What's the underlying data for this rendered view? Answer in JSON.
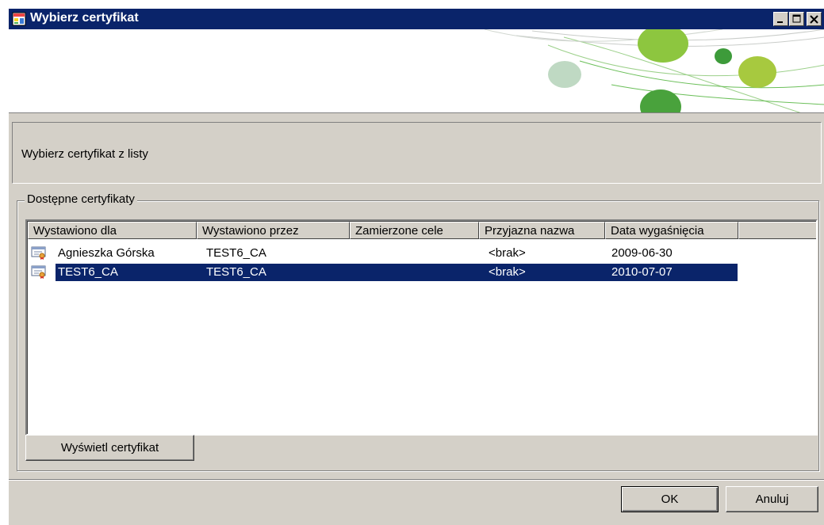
{
  "window": {
    "title": "Wybierz certyfikat"
  },
  "description": {
    "text": "Wybierz certyfikat z listy"
  },
  "group": {
    "label": "Dostępne certyfikaty"
  },
  "list": {
    "columns": [
      "Wystawiono dla",
      "Wystawiono przez",
      "Zamierzone cele",
      "Przyjazna nazwa",
      "Data wygaśnięcia"
    ],
    "rows": [
      [
        "Agnieszka Górska",
        "TEST6_CA",
        "",
        "<brak>",
        "2009-06-30"
      ],
      [
        "TEST6_CA",
        "TEST6_CA",
        "",
        "<brak>",
        "2010-07-07"
      ]
    ],
    "selected_index": 1
  },
  "buttons": {
    "view_cert": "Wyświetl certyfikat",
    "ok": "OK",
    "cancel": "Anuluj"
  },
  "colors": {
    "titlebar": "#0a246a",
    "selection": "#0a246a",
    "dialog_bg": "#d4d0c8",
    "banner_green": "#8dc63f"
  },
  "icons": {
    "app": "certificate-app-icon",
    "row": "certificate-icon",
    "titlebar_buttons": [
      "minimize-icon",
      "maximize-icon",
      "close-icon"
    ]
  }
}
